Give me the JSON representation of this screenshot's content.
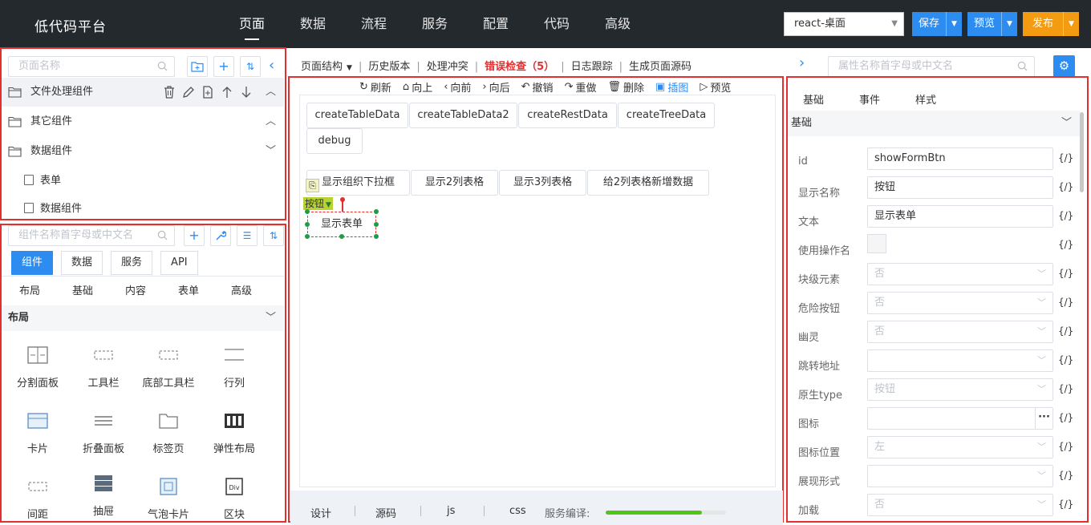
{
  "header": {
    "app_title": "低代码平台",
    "nav": [
      "页面",
      "数据",
      "流程",
      "服务",
      "配置",
      "代码",
      "高级"
    ],
    "active_nav": "页面",
    "env_select": "react-桌面",
    "save_label": "保存",
    "preview_label": "预览",
    "publish_label": "发布",
    "colors": {
      "topbar": "#24292e",
      "primary": "#2d8cf0",
      "publish": "#f39c12",
      "highlight": "#e03030"
    }
  },
  "page_panel": {
    "search_placeholder": "页面名称",
    "tree": [
      {
        "label": "文件处理组件",
        "expanded": true
      },
      {
        "label": "其它组件",
        "expanded": true
      },
      {
        "label": "数据组件",
        "expanded": true
      }
    ],
    "leaves": [
      "表单",
      "数据组件"
    ]
  },
  "component_panel": {
    "search_placeholder": "组件名称首字母或中文名",
    "tabs": [
      "组件",
      "数据",
      "服务",
      "API"
    ],
    "active_tab": "组件",
    "categories": [
      "布局",
      "基础",
      "内容",
      "表单",
      "高级"
    ],
    "section_title": "布局",
    "items": [
      "分割面板",
      "工具栏",
      "底部工具栏",
      "行列",
      "卡片",
      "折叠面板",
      "标签页",
      "弹性布局",
      "间距",
      "抽屉",
      "气泡卡片",
      "区块"
    ]
  },
  "center": {
    "tabs": [
      "页面结构",
      "历史版本",
      "处理冲突",
      "错误检查（5）",
      "日志跟踪",
      "生成页面源码"
    ],
    "actions": [
      "刷新",
      "向上",
      "向前",
      "向后",
      "撤销",
      "重做",
      "删除",
      "插图",
      "预览"
    ],
    "canvas_row1": [
      "createTableData",
      "createTableData2",
      "createRestData",
      "createTreeData",
      "debug"
    ],
    "canvas_row2": [
      "显示组织下拉框",
      "显示2列表格",
      "显示3列表格",
      "给2列表格新增数据"
    ],
    "selected_tag": "按钮",
    "selected_button": "显示表单",
    "bottom_tabs": [
      "设计",
      "源码",
      "js",
      "css"
    ],
    "compile_label": "服务编译:",
    "compile_progress": 0.8
  },
  "props": {
    "search_placeholder": "属性名称首字母或中文名",
    "tabs": [
      "基础",
      "事件",
      "样式"
    ],
    "section_title": "基础",
    "code_label": "{/}",
    "rows": [
      {
        "label": "id",
        "value": "showFormBtn",
        "kind": "text"
      },
      {
        "label": "显示名称",
        "value": "按钮",
        "kind": "text"
      },
      {
        "label": "文本",
        "value": "显示表单",
        "kind": "text"
      },
      {
        "label": "使用操作名",
        "value": "",
        "kind": "check"
      },
      {
        "label": "块级元素",
        "value": "否",
        "kind": "select"
      },
      {
        "label": "危险按钮",
        "value": "否",
        "kind": "select"
      },
      {
        "label": "幽灵",
        "value": "否",
        "kind": "select"
      },
      {
        "label": "跳转地址",
        "value": "",
        "kind": "select"
      },
      {
        "label": "原生type",
        "value": "按钮",
        "kind": "select"
      },
      {
        "label": "图标",
        "value": "",
        "kind": "icon"
      },
      {
        "label": "图标位置",
        "value": "左",
        "kind": "select"
      },
      {
        "label": "展现形式",
        "value": "",
        "kind": "select"
      },
      {
        "label": "加载",
        "value": "否",
        "kind": "select"
      }
    ]
  }
}
